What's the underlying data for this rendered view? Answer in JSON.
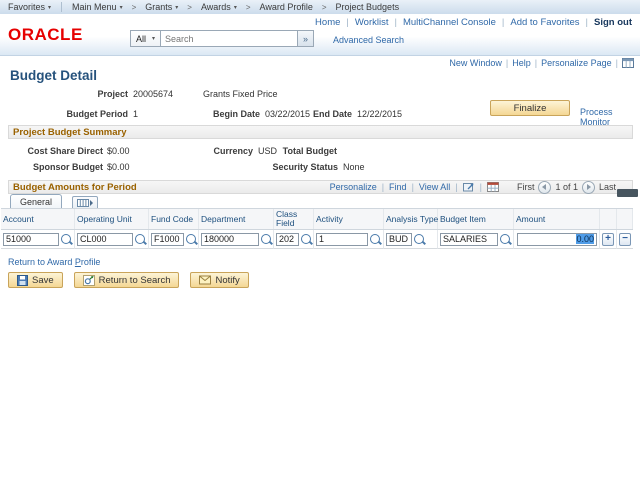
{
  "colors": {
    "oracle_red": "#e60000",
    "link_blue": "#3069a8",
    "section_title_brown": "#9a6200",
    "button_tan": "#f4d794",
    "selection_blue": "#4f9ce8",
    "breadcrumb_bg": "#ccdcec",
    "grid_header_text": "#1d4f7e"
  },
  "breadcrumb": {
    "favorites_label": "Favorites",
    "main_menu_label": "Main Menu",
    "trail": [
      "Grants",
      "Awards",
      "Award Profile",
      "Project Budgets"
    ]
  },
  "utility_nav": {
    "links": [
      "Home",
      "Worklist",
      "MultiChannel Console",
      "Add to Favorites"
    ],
    "sign_out_label": "Sign out"
  },
  "masthead": {
    "logo_text": "ORACLE",
    "search_scope": "All",
    "search_placeholder": "Search",
    "search_go_label": "»",
    "advanced_search_label": "Advanced Search"
  },
  "page_toolbar": {
    "new_window_label": "New Window",
    "help_label": "Help",
    "personalize_page_label": "Personalize Page"
  },
  "detail": {
    "title": "Budget Detail",
    "project_label": "Project",
    "project_id": "20005674",
    "project_description": "Grants Fixed Price",
    "budget_period_label": "Budget Period",
    "budget_period_value": "1",
    "begin_date_label": "Begin Date",
    "begin_date_value": "03/22/2015",
    "end_date_label": "End Date",
    "end_date_value": "12/22/2015",
    "finalize_button_label": "Finalize",
    "process_monitor_label": "Process Monitor"
  },
  "summary": {
    "section_title": "Project Budget Summary",
    "cost_share_direct_label": "Cost Share Direct",
    "cost_share_direct_value": "$0.00",
    "sponsor_budget_label": "Sponsor Budget",
    "sponsor_budget_value": "$0.00",
    "currency_label": "Currency",
    "currency_value": "USD",
    "total_budget_label": "Total Budget",
    "total_budget_value": "",
    "security_status_label": "Security Status",
    "security_status_value": "None"
  },
  "grid": {
    "section_title": "Budget Amounts for Period",
    "toolbar": {
      "personalize_label": "Personalize",
      "find_label": "Find",
      "view_all_label": "View All",
      "first_label": "First",
      "page_indicator": "1 of 1",
      "last_label": "Last"
    },
    "active_tab_label": "General",
    "columns": [
      "Account",
      "Operating Unit",
      "Fund Code",
      "Department",
      "Class Field",
      "Activity",
      "Analysis Type",
      "Budget Item",
      "Amount"
    ],
    "rows": [
      {
        "account": "51000",
        "operating_unit": "CL000",
        "fund_code": "F1000",
        "department": "180000",
        "class_field": "202",
        "activity": "1",
        "analysis_type": "BUD",
        "budget_item": "SALARIES",
        "amount": "0.00"
      }
    ],
    "add_row_label": "+",
    "delete_row_label": "−"
  },
  "footer": {
    "return_link_prefix": "Return to Award ",
    "return_link_accent": "Profile",
    "save_button_label": "Save",
    "return_to_search_button_label": "Return to Search",
    "notify_button_label": "Notify"
  }
}
